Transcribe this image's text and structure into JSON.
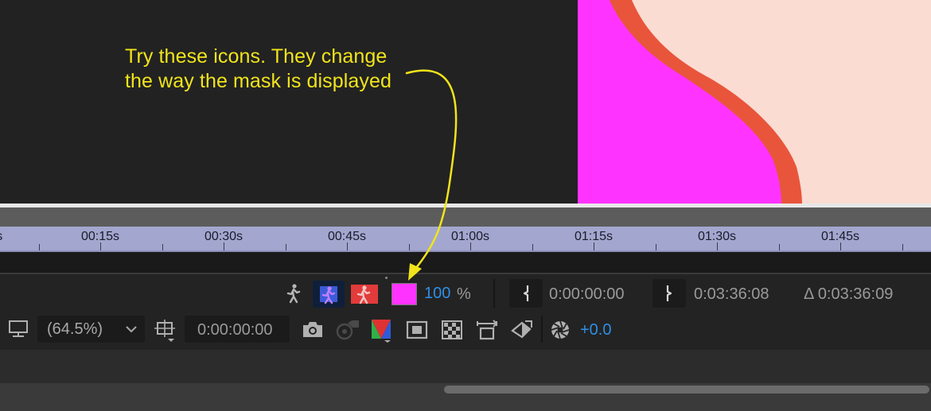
{
  "annotation": {
    "line1": "Try these icons. They change",
    "line2": "the way the mask is displayed"
  },
  "ruler": {
    "ticks": [
      "00:15s",
      "00:30s",
      "00:45s",
      "01:00s",
      "01:15s",
      "01:30s",
      "01:45s"
    ]
  },
  "timeline_toolbar": {
    "opacity_value": "100",
    "opacity_unit": "%",
    "in_point": "0:00:00:00",
    "out_point": "0:03:36:08",
    "duration": "Δ 0:03:36:09"
  },
  "viewer_toolbar": {
    "magnification": "(64.5%)",
    "current_time": "0:00:00:00",
    "exposure": "+0.0"
  },
  "colors": {
    "annotation": "#f1e41b",
    "mask_color": "#ff33ff",
    "accent_blue": "#2f8ee8",
    "preview_peach": "#fbdcd2",
    "preview_orange": "#e8553b",
    "preview_magenta": "#ff33ff"
  }
}
